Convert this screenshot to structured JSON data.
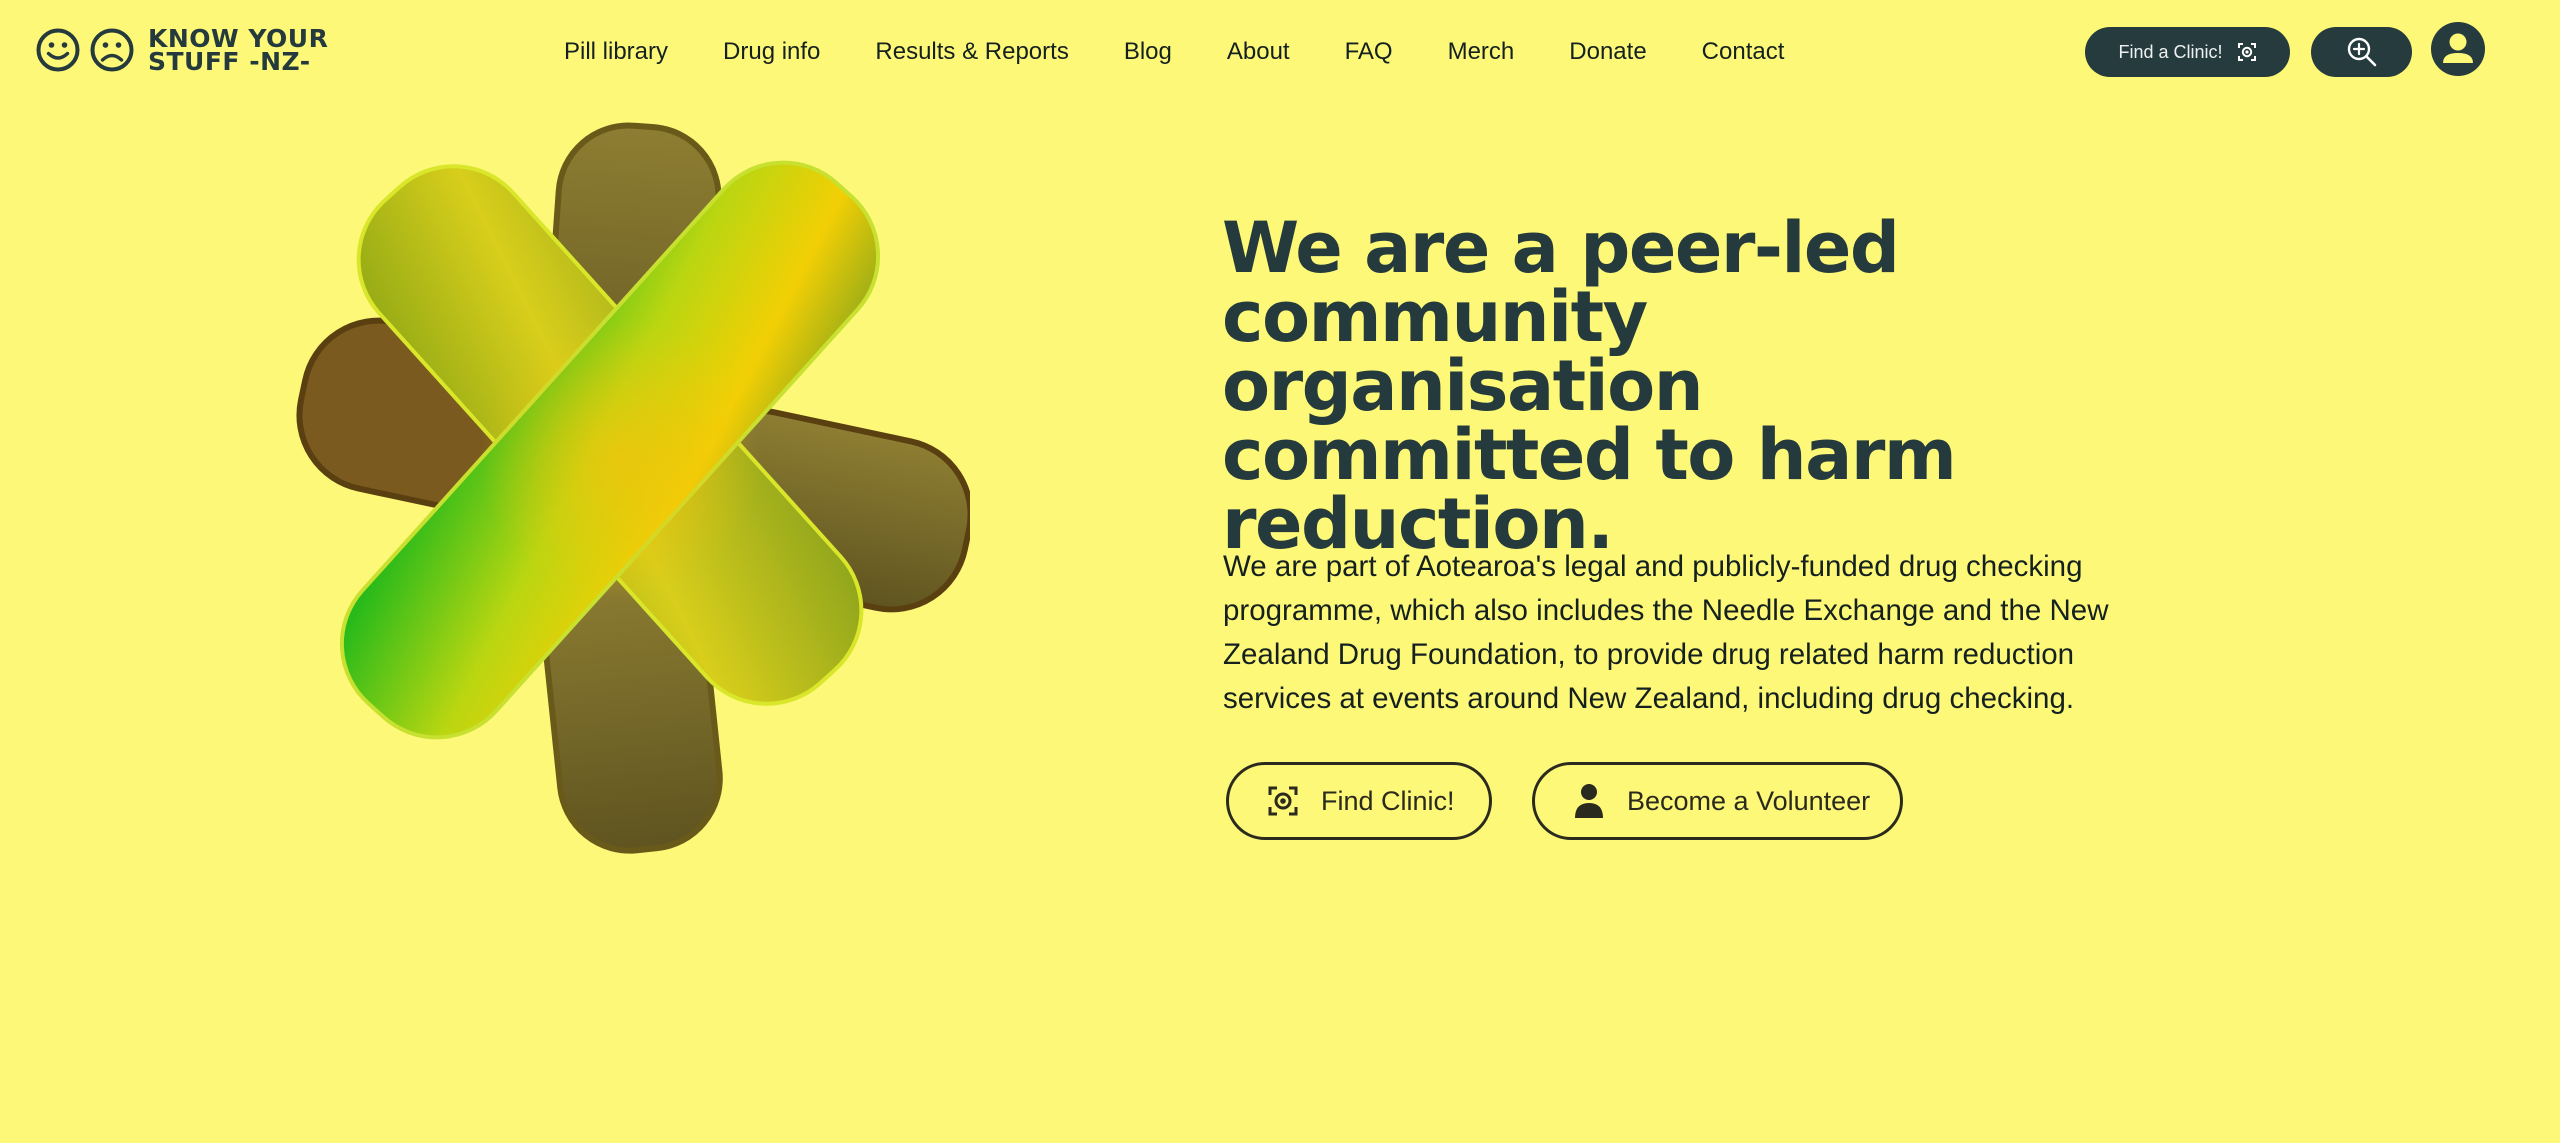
{
  "header": {
    "logo": {
      "line1": "KNOW YOUR",
      "line2": "STUFF -NZ-",
      "icons": [
        "smiley-face-icon",
        "frowning-face-icon"
      ]
    },
    "nav": [
      {
        "label": "Pill library"
      },
      {
        "label": "Drug info"
      },
      {
        "label": "Results & Reports"
      },
      {
        "label": "Blog"
      },
      {
        "label": "About"
      },
      {
        "label": "FAQ"
      },
      {
        "label": "Merch"
      },
      {
        "label": "Donate"
      },
      {
        "label": "Contact"
      }
    ],
    "find_clinic_label": "Find a Clinic!",
    "find_clinic_icon": "location-target-icon",
    "search_icon": "zoom-search-icon",
    "account_icon": "user-account-icon"
  },
  "hero": {
    "title": "We are a peer-led community organisation committed to harm reduction.",
    "body": "We are part of Aotearoa's legal and publicly-funded drug checking programme, which also includes the Needle Exchange and the New Zealand Drug Foundation, to provide drug related harm reduction services at events around New Zealand, including drug checking.",
    "buttons": {
      "find_clinic": "Find Clinic!",
      "volunteer": "Become a Volunteer"
    },
    "illustration": "green-gold-asterisk-graphic"
  },
  "colors": {
    "background": "#fdf878",
    "dark": "#263b3d",
    "text": "#15211f"
  }
}
